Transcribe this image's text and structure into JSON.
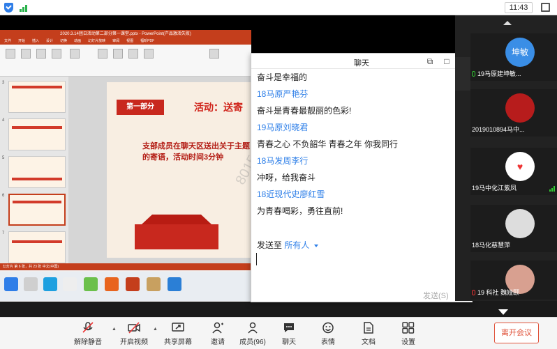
{
  "status_bar": {
    "time": "11:43"
  },
  "ppt": {
    "window_title": "2020.3.14团日活动第二部分第一课堂.pptx - PowerPoint(产品激活失败)",
    "menus": [
      "文件",
      "开始",
      "插入",
      "设计",
      "切换",
      "动画",
      "幻灯片放映",
      "审阅",
      "视图",
      "福昕PDF"
    ],
    "thumb_numbers": [
      "3",
      "4",
      "5",
      "6",
      "7"
    ],
    "slide_ribbon": "第一部分",
    "slide_heading": "活动：送寄",
    "slide_body": "支部成员在聊天区送出关于主题的寄语，活动时间3分钟",
    "watermark": "8015022",
    "status_line": "幻灯片 第 6 张，共 23 张    中文(中国)"
  },
  "chat": {
    "title": "聊天",
    "messages": [
      {
        "sender": "",
        "text": "奋斗是幸福的"
      },
      {
        "sender": "18马原严艳芬",
        "text": ""
      },
      {
        "sender": "",
        "text": "奋斗是青春最靓丽的色彩!"
      },
      {
        "sender": "19马原刘晓君",
        "text": ""
      },
      {
        "sender": "",
        "text": "青春之心 不负韶华  青春之年 你我同行"
      },
      {
        "sender": "18马发周李行",
        "text": ""
      },
      {
        "sender": "",
        "text": "冲呀，给我奋斗"
      },
      {
        "sender": "18近现代史廖红雪",
        "text": ""
      },
      {
        "sender": "",
        "text": "为青春喝彩，勇往直前!"
      }
    ],
    "send_to_label": "发送至",
    "send_to_target": "所有人",
    "send_label": "发送(S)"
  },
  "videos": [
    {
      "avatar_text": "坤敏",
      "name": "19马原建坤敏..."
    },
    {
      "avatar_text": "",
      "name": "2019010894马中..."
    },
    {
      "avatar_text": "",
      "name": "19马中化江紫凤"
    },
    {
      "avatar_text": "",
      "name": "18马化慈慧萍"
    },
    {
      "avatar_text": "",
      "name": "19 科社 魏娅颐"
    }
  ],
  "toolbar": {
    "unmute": "解除静音",
    "start_video": "开启视频",
    "share_screen": "共享屏幕",
    "invite": "邀请",
    "members": "成员(96)",
    "chat": "聊天",
    "reactions": "表情",
    "docs": "文档",
    "settings": "设置",
    "leave": "离开会议"
  },
  "colors": {
    "accent_blue": "#2e7fe8",
    "ppt_red": "#c43e1c",
    "leave_red": "#e0533b"
  }
}
